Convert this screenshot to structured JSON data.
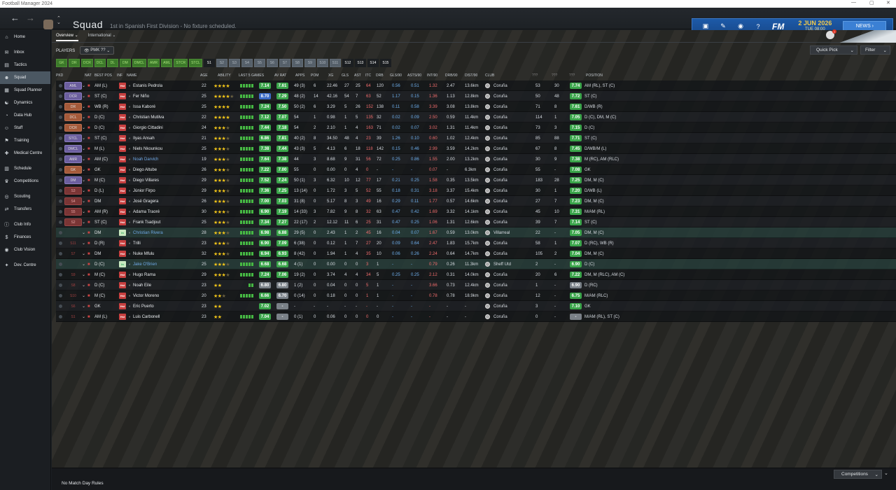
{
  "app": {
    "title": "Football Manager 2024"
  },
  "header": {
    "title": "Squad",
    "subtitle": "1st in Spanish First Division - No fixture scheduled.",
    "date": "2 JUN 2026",
    "time": "TUE 08:00",
    "news": "NEWS",
    "logo": "FM"
  },
  "sidebar": {
    "items": [
      {
        "label": "Home",
        "icon": "home-icon"
      },
      {
        "label": "Inbox",
        "icon": "inbox-icon"
      },
      {
        "label": "Tactics",
        "icon": "tactics-icon"
      },
      {
        "label": "Squad",
        "icon": "squad-icon"
      },
      {
        "label": "Squad Planner",
        "icon": "planner-icon"
      },
      {
        "label": "Dynamics",
        "icon": "dynamics-icon"
      },
      {
        "label": "Data Hub",
        "icon": "datahub-icon"
      },
      {
        "label": "Staff",
        "icon": "staff-icon"
      },
      {
        "label": "Training",
        "icon": "training-icon"
      },
      {
        "label": "Medical Centre",
        "icon": "medical-icon"
      },
      {
        "label": "Schedule",
        "icon": "schedule-icon"
      },
      {
        "label": "Competitions",
        "icon": "trophy-icon"
      },
      {
        "label": "Scouting",
        "icon": "scouting-icon"
      },
      {
        "label": "Transfers",
        "icon": "transfers-icon"
      },
      {
        "label": "Club Info",
        "icon": "info-icon"
      },
      {
        "label": "Finances",
        "icon": "finances-icon"
      },
      {
        "label": "Club Vision",
        "icon": "vision-icon"
      },
      {
        "label": "Dev. Centre",
        "icon": "devcentre-icon"
      }
    ]
  },
  "tabs": [
    {
      "label": "Overview ⌄"
    },
    {
      "label": "International ⌄"
    }
  ],
  "players_label": "PLAYERS",
  "pmk": "PMK ??",
  "quick_pick": "Quick Pick",
  "filter": "Filter",
  "position_filters": [
    "GK",
    "DR",
    "DCR",
    "DCL",
    "DL",
    "DM",
    "DMCL",
    "AMR",
    "AML",
    "STCR",
    "STCL",
    "S1",
    "S2",
    "S3",
    "S4",
    "S5",
    "S6",
    "S7",
    "S8",
    "S9",
    "S10",
    "S11",
    "S12",
    "S13",
    "S14",
    "S15"
  ],
  "columns": {
    "pkd": "PKD",
    "nat": "NAT",
    "best_pos": "BEST POS",
    "inf": "INF",
    "name": "NAME",
    "age": "AGE",
    "ability": "ABILITY",
    "last5": "LAST 5 GAMES",
    "av_rat": "AV RAT",
    "apps": "APPS",
    "pom": "POM",
    "xg": "XG",
    "gls": "GLS",
    "ast": "AST",
    "itc": "ITC",
    "drb": "DRB",
    "gls90": "GLS/90",
    "asts90": "ASTS/90",
    "int90": "INT/90",
    "drb90": "DRB/90",
    "dist90": "DIST/90",
    "club": "CLUB",
    "c1": "???",
    "c2": "???",
    "c3": "???",
    "position": "POSITION"
  },
  "players": [
    {
      "pkd": "AML",
      "pc": "p",
      "pos": "AM (L)",
      "name": "Estanis Pedrola",
      "age": "22",
      "stars": 4,
      "half": false,
      "rt1": "7.14",
      "rt2": "7.61",
      "apps": "49 (3)",
      "pom": "6",
      "xg": "22.46",
      "gls": "27",
      "ast": "25",
      "itc": "64",
      "drb": "120",
      "glsp": "0.56",
      "astp": "0.51",
      "intp": "1.32",
      "drbp": "2.47",
      "dist": "13.6km",
      "club": "Coruña",
      "n1": "53",
      "n2": "30",
      "rt3": "7.74",
      "position": "AM (RL), ST (C)"
    },
    {
      "pkd": "DCR",
      "pc": "p",
      "pos": "ST (C)",
      "name": "Fer Niño",
      "age": "25",
      "stars": 4,
      "half": true,
      "rt1": "8.70",
      "rt1b": true,
      "rt2": "7.29",
      "apps": "48 (2)",
      "pom": "14",
      "xg": "42.16",
      "gls": "54",
      "ast": "7",
      "itc": "63",
      "drb": "52",
      "glsp": "1.17",
      "astp": "0.15",
      "intp": "1.36",
      "drbp": "1.13",
      "dist": "12.8km",
      "club": "Coruña",
      "n1": "50",
      "n2": "48",
      "rt3": "7.72",
      "position": "ST (C)"
    },
    {
      "pkd": "DR",
      "pc": "o",
      "pos": "WB (R)",
      "name": "Issa Kaboré",
      "age": "25",
      "stars": 4,
      "half": false,
      "rt1": "7.24",
      "rt2": "7.50",
      "apps": "50 (2)",
      "pom": "6",
      "xg": "3.29",
      "gls": "5",
      "ast": "26",
      "itc": "152",
      "drb": "138",
      "glsp": "0.11",
      "astp": "0.58",
      "intp": "3.39",
      "drbp": "3.08",
      "dist": "13.8km",
      "club": "Coruña",
      "n1": "71",
      "n2": "8",
      "rt3": "7.61",
      "position": "D/WB (R)"
    },
    {
      "pkd": "DCL",
      "pc": "o",
      "pos": "D (C)",
      "name": "Christian Mutilva",
      "age": "22",
      "stars": 4,
      "half": false,
      "rt1": "7.12",
      "rt2": "7.07",
      "apps": "54",
      "pom": "1",
      "xg": "0.98",
      "gls": "1",
      "ast": "5",
      "itc": "135",
      "drb": "32",
      "glsp": "0.02",
      "astp": "0.09",
      "intp": "2.50",
      "drbp": "0.59",
      "dist": "11.4km",
      "club": "Coruña",
      "n1": "114",
      "n2": "1",
      "rt3": "7.05",
      "position": "D (C), DM, M (C)"
    },
    {
      "pkd": "DCR",
      "pc": "o",
      "pos": "D (C)",
      "name": "Giorgio Cittadini",
      "age": "24",
      "stars": 3,
      "half": true,
      "rt1": "7.44",
      "rt2": "7.18",
      "apps": "54",
      "pom": "2",
      "xg": "2.10",
      "gls": "1",
      "ast": "4",
      "itc": "163",
      "drb": "71",
      "glsp": "0.02",
      "astp": "0.07",
      "intp": "3.02",
      "drbp": "1.31",
      "dist": "11.4km",
      "club": "Coruña",
      "n1": "73",
      "n2": "3",
      "rt3": "7.15",
      "position": "D (C)"
    },
    {
      "pkd": "STCL",
      "pc": "p",
      "pos": "ST (C)",
      "name": "Ilyas Ansah",
      "age": "21",
      "stars": 3,
      "half": true,
      "rt1": "6.86",
      "rt2": "7.81",
      "apps": "40 (2)",
      "pom": "8",
      "xg": "34.50",
      "gls": "48",
      "ast": "4",
      "itc": "23",
      "drb": "39",
      "glsp": "1.26",
      "astp": "0.10",
      "intp": "0.60",
      "drbp": "1.02",
      "dist": "12.4km",
      "club": "Coruña",
      "n1": "85",
      "n2": "88",
      "rt3": "7.71",
      "position": "ST (C)"
    },
    {
      "pkd": "DMCL",
      "pc": "p",
      "pos": "M (L)",
      "name": "Niels Nkounkou",
      "age": "25",
      "stars": 3,
      "half": true,
      "rt1": "7.38",
      "rt2": "7.44",
      "apps": "43 (3)",
      "pom": "5",
      "xg": "4.13",
      "gls": "6",
      "ast": "18",
      "itc": "118",
      "drb": "142",
      "glsp": "0.15",
      "astp": "0.46",
      "intp": "2.99",
      "drbp": "3.59",
      "dist": "14.2km",
      "club": "Coruña",
      "n1": "67",
      "n2": "8",
      "rt3": "7.45",
      "position": "D/WB/M (L)"
    },
    {
      "pkd": "AMR",
      "pc": "p",
      "pos": "AM (C)",
      "name": "Noah Darvich",
      "age": "19",
      "stars": 3,
      "half": true,
      "rt1": "7.64",
      "rt2": "7.38",
      "apps": "44",
      "pom": "3",
      "xg": "8.68",
      "gls": "9",
      "ast": "31",
      "itc": "56",
      "drb": "72",
      "glsp": "0.25",
      "astp": "0.86",
      "intp": "1.55",
      "drbp": "2.00",
      "dist": "13.2km",
      "club": "Coruña",
      "n1": "30",
      "n2": "9",
      "rt3": "7.38",
      "position": "M (RC), AM (RLC)",
      "blue": true
    },
    {
      "pkd": "GK",
      "pc": "o",
      "pos": "GK",
      "name": "Diego Altube",
      "age": "26",
      "stars": 3,
      "half": true,
      "rt1": "7.22",
      "rt2": "7.00",
      "apps": "55",
      "pom": "0",
      "xg": "0.00",
      "gls": "0",
      "ast": "4",
      "itc": "0",
      "drb": "-",
      "glsp": "-",
      "astp": "-",
      "intp": "0.07",
      "drbp": "-",
      "dist": "6.3km",
      "club": "Coruña",
      "n1": "55",
      "n2": "-",
      "rt3": "7.08",
      "position": "GK"
    },
    {
      "pkd": "DM",
      "pc": "p",
      "pos": "M (C)",
      "name": "Diego Villares",
      "age": "29",
      "stars": 3,
      "half": true,
      "rt1": "7.52",
      "rt2": "7.24",
      "apps": "50 (1)",
      "pom": "3",
      "xg": "6.32",
      "gls": "10",
      "ast": "12",
      "itc": "77",
      "drb": "17",
      "glsp": "0.21",
      "astp": "0.25",
      "intp": "1.58",
      "drbp": "0.35",
      "dist": "13.5km",
      "club": "Coruña",
      "n1": "183",
      "n2": "28",
      "rt3": "7.25",
      "position": "DM, M (C)"
    },
    {
      "pkd": "S3",
      "pc": "r",
      "pos": "D (L)",
      "name": "Júnior Firpo",
      "age": "29",
      "stars": 3,
      "half": true,
      "rt1": "7.36",
      "rt2": "7.25",
      "apps": "13 (14)",
      "pom": "0",
      "xg": "1.72",
      "gls": "3",
      "ast": "5",
      "itc": "52",
      "drb": "55",
      "glsp": "0.18",
      "astp": "0.31",
      "intp": "3.18",
      "drbp": "3.37",
      "dist": "15.4km",
      "club": "Coruña",
      "n1": "30",
      "n2": "1",
      "rt3": "7.20",
      "position": "D/WB (L)"
    },
    {
      "pkd": "S4",
      "pc": "r",
      "pos": "DM",
      "name": "José Gragera",
      "age": "26",
      "stars": 3,
      "half": true,
      "rt1": "7.00",
      "rt2": "7.03",
      "apps": "31 (8)",
      "pom": "0",
      "xg": "5.17",
      "gls": "8",
      "ast": "3",
      "itc": "49",
      "drb": "16",
      "glsp": "0.29",
      "astp": "0.11",
      "intp": "1.77",
      "drbp": "0.57",
      "dist": "14.6km",
      "club": "Coruña",
      "n1": "27",
      "n2": "7",
      "rt3": "7.23",
      "position": "DM, M (C)"
    },
    {
      "pkd": "S5",
      "pc": "r",
      "pos": "AM (R)",
      "name": "Adama Traoré",
      "age": "30",
      "stars": 3,
      "half": true,
      "rt1": "6.90",
      "rt2": "7.19",
      "apps": "14 (33)",
      "pom": "3",
      "xg": "7.82",
      "gls": "9",
      "ast": "8",
      "itc": "32",
      "drb": "63",
      "glsp": "0.47",
      "astp": "0.42",
      "intp": "1.69",
      "drbp": "3.32",
      "dist": "14.1km",
      "club": "Coruña",
      "n1": "45",
      "n2": "10",
      "rt3": "7.31",
      "position": "M/AM (RL)"
    },
    {
      "pkd": "S2",
      "pc": "r",
      "pos": "ST (C)",
      "name": "Frank Tsadjout",
      "age": "25",
      "stars": 3,
      "half": true,
      "rt1": "7.34",
      "rt2": "7.27",
      "apps": "22 (17)",
      "pom": "2",
      "xg": "12.12",
      "gls": "11",
      "ast": "6",
      "itc": "25",
      "drb": "31",
      "glsp": "0.47",
      "astp": "0.25",
      "intp": "1.06",
      "drbp": "1.31",
      "dist": "12.6km",
      "club": "Coruña",
      "n1": "39",
      "n2": "7",
      "rt3": "7.14",
      "position": "ST (C)"
    },
    {
      "pkd": "",
      "pc": "n",
      "pos": "DM",
      "name": "Christian Rivera",
      "age": "28",
      "stars": 3,
      "half": true,
      "rt1": "6.98",
      "rt2": "6.88",
      "apps": "29 (5)",
      "pom": "0",
      "xg": "2.43",
      "gls": "1",
      "ast": "2",
      "itc": "45",
      "drb": "16",
      "glsp": "0.04",
      "astp": "0.07",
      "intp": "1.67",
      "drbp": "0.59",
      "dist": "13.0km",
      "club": "Villarreal",
      "n1": "22",
      "n2": "-",
      "rt3": "7.05",
      "position": "DM, M (C)",
      "loan": true,
      "blue": true
    },
    {
      "pkd": "S11",
      "pc": "n",
      "pos": "D (R)",
      "name": "Trilli",
      "age": "23",
      "stars": 3,
      "half": true,
      "rt1": "6.90",
      "rt2": "7.09",
      "apps": "6 (38)",
      "pom": "0",
      "xg": "0.12",
      "gls": "1",
      "ast": "7",
      "itc": "27",
      "drb": "20",
      "glsp": "0.09",
      "astp": "0.64",
      "intp": "2.47",
      "drbp": "1.83",
      "dist": "15.7km",
      "club": "Coruña",
      "n1": "58",
      "n2": "1",
      "rt3": "7.07",
      "position": "D (RC), WB (R)"
    },
    {
      "pkd": "S7",
      "pc": "n",
      "pos": "DM",
      "name": "Nuke Mfulu",
      "age": "32",
      "stars": 3,
      "half": true,
      "rt1": "6.94",
      "rt2": "6.93",
      "apps": "8 (42)",
      "pom": "0",
      "xg": "1.94",
      "gls": "1",
      "ast": "4",
      "itc": "35",
      "drb": "10",
      "glsp": "0.06",
      "astp": "0.26",
      "intp": "2.24",
      "drbp": "0.64",
      "dist": "14.7km",
      "club": "Coruña",
      "n1": "105",
      "n2": "2",
      "rt3": "7.04",
      "position": "DM, M (C)"
    },
    {
      "pkd": "",
      "pc": "n",
      "pos": "D (C)",
      "name": "Jake O'Brien",
      "age": "25",
      "stars": 3,
      "half": true,
      "rt1": "6.68",
      "rt2": "6.68",
      "apps": "4 (1)",
      "pom": "0",
      "xg": "0.00",
      "gls": "0",
      "ast": "0",
      "itc": "3",
      "drb": "1",
      "glsp": "-",
      "astp": "-",
      "intp": "0.79",
      "drbp": "0.26",
      "dist": "11.3km",
      "club": "Sheff Utd",
      "n1": "2",
      "n2": "-",
      "rt3": "6.90",
      "position": "D (C)",
      "loan": true,
      "blue": true
    },
    {
      "pkd": "S9",
      "pc": "n",
      "pos": "M (C)",
      "name": "Hugo Rama",
      "age": "29",
      "stars": 3,
      "half": true,
      "rt1": "7.24",
      "rt2": "7.06",
      "apps": "19 (2)",
      "pom": "0",
      "xg": "3.74",
      "gls": "4",
      "ast": "4",
      "itc": "34",
      "drb": "5",
      "glsp": "0.25",
      "astp": "0.25",
      "intp": "2.12",
      "drbp": "0.31",
      "dist": "14.0km",
      "club": "Coruña",
      "n1": "20",
      "n2": "6",
      "rt3": "7.22",
      "position": "DM, M (RLC), AM (C)"
    },
    {
      "pkd": "S8",
      "pc": "n",
      "pos": "D (C)",
      "name": "Noah Eile",
      "age": "23",
      "stars": 2,
      "half": false,
      "rt1": "6.80",
      "rt1g": true,
      "rt2": "6.80",
      "rt2g": true,
      "apps": "1 (2)",
      "pom": "0",
      "xg": "0.04",
      "gls": "0",
      "ast": "0",
      "itc": "5",
      "drb": "1",
      "glsp": "-",
      "astp": "-",
      "intp": "3.66",
      "drbp": "0.73",
      "dist": "12.4km",
      "club": "Coruña",
      "n1": "1",
      "n2": "-",
      "rt3": "6.90",
      "rt3g": true,
      "position": "D (RC)"
    },
    {
      "pkd": "S10",
      "pc": "n",
      "pos": "M (C)",
      "name": "Victor Moreno",
      "age": "20",
      "stars": 2,
      "half": true,
      "rt1": "6.66",
      "rt2": "6.70",
      "rt2g": true,
      "apps": "0 (14)",
      "pom": "0",
      "xg": "0.18",
      "gls": "0",
      "ast": "0",
      "itc": "1",
      "drb": "1",
      "glsp": "-",
      "astp": "-",
      "intp": "0.78",
      "drbp": "0.78",
      "dist": "18.9km",
      "club": "Coruña",
      "n1": "12",
      "n2": "-",
      "rt3": "6.75",
      "position": "M/AM (RLC)"
    },
    {
      "pkd": "S6",
      "pc": "n",
      "pos": "GK",
      "name": "Eric Puerto",
      "age": "23",
      "stars": 2,
      "half": false,
      "rt1": "7.02",
      "rt2": "-",
      "rt2g": true,
      "apps": "-",
      "pom": "-",
      "xg": "-",
      "gls": "-",
      "ast": "-",
      "itc": "-",
      "drb": "-",
      "glsp": "-",
      "astp": "-",
      "intp": "-",
      "drbp": "-",
      "dist": "-",
      "club": "Coruña",
      "n1": "3",
      "n2": "-",
      "rt3": "7.10",
      "position": "GK"
    },
    {
      "pkd": "S1",
      "pc": "n",
      "pos": "AM (L)",
      "name": "Luis Carbonell",
      "age": "23",
      "stars": 2,
      "half": false,
      "rt1": "7.04",
      "rt2": "-",
      "rt2g": true,
      "apps": "0 (1)",
      "pom": "0",
      "xg": "0.06",
      "gls": "0",
      "ast": "0",
      "itc": "0",
      "drb": "0",
      "glsp": "-",
      "astp": "-",
      "intp": "-",
      "drbp": "-",
      "dist": "-",
      "club": "Coruña",
      "n1": "0",
      "n2": "-",
      "rt3": "-",
      "rt3g": true,
      "position": "M/AM (RL), ST (C)"
    }
  ],
  "bottom": {
    "no_match": "No Match Day Rules",
    "competitions": "Competitions"
  }
}
